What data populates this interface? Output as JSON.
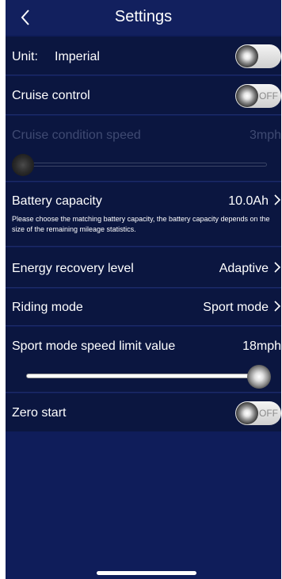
{
  "header": {
    "title": "Settings"
  },
  "unit": {
    "label": "Unit:",
    "value": "Imperial"
  },
  "cruise_control": {
    "label": "Cruise control",
    "toggle_text": "OFF"
  },
  "cruise_speed": {
    "label": "Cruise condition speed",
    "value": "3mph"
  },
  "battery": {
    "label": "Battery capacity",
    "value": "10.0Ah",
    "note": "Please choose the matching battery capacity, the battery capacity depends on the size of the remaining mileage statistics."
  },
  "energy_recovery": {
    "label": "Energy recovery level",
    "value": "Adaptive"
  },
  "riding_mode": {
    "label": "Riding mode",
    "value": "Sport mode"
  },
  "sport_speed": {
    "label": "Sport mode speed limit value",
    "value": "18mph"
  },
  "zero_start": {
    "label": "Zero start",
    "toggle_text": "OFF"
  },
  "colors": {
    "background": "#0f1d5a",
    "row": "#0b1640",
    "disabled_text": "#3f4a72"
  }
}
